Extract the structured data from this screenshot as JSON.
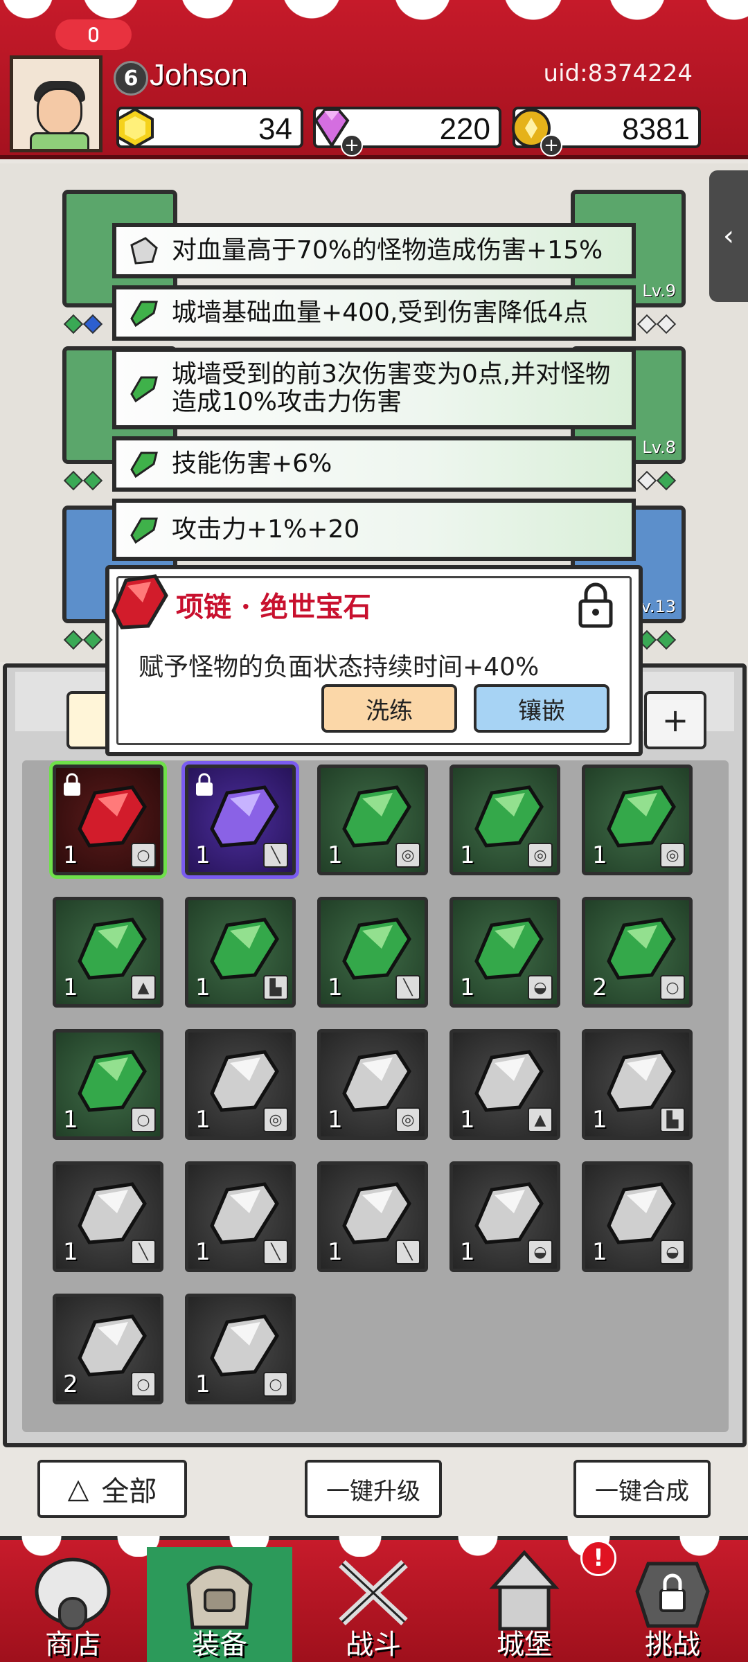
{
  "header": {
    "player_name": "Johson",
    "level": "6",
    "uid": "uid:8374224",
    "currencies": [
      {
        "name": "gem",
        "value": "34",
        "color": "#f5d21c"
      },
      {
        "name": "diamond",
        "value": "220",
        "color": "#d46ee0"
      },
      {
        "name": "coin",
        "value": "8381",
        "color": "#e5b21a"
      }
    ]
  },
  "equipment": {
    "levels": [
      "Lv.9",
      "Lv.8",
      "Lv.13"
    ]
  },
  "affixes": [
    {
      "text": "对血量高于70%的怪物造成伤害+15%",
      "gem": "gray"
    },
    {
      "text": "城墙基础血量+400,受到伤害降低4点",
      "gem": "green"
    },
    {
      "text": "城墙受到的前3次伤害变为0点,并对怪物造成10%攻击力伤害",
      "gem": "green"
    },
    {
      "text": "技能伤害+6%",
      "gem": "green"
    },
    {
      "text": "攻击力+1%+20",
      "gem": "green"
    }
  ],
  "popup": {
    "title": "项链 · 绝世宝石",
    "description": "赋予怪物的负面状态持续时间+40%",
    "refine_label": "洗练",
    "inlay_label": "镶嵌"
  },
  "inventory": {
    "cells": [
      {
        "color": "red",
        "count": "1",
        "slot": "necklace",
        "locked": true
      },
      {
        "color": "purple",
        "count": "1",
        "slot": "weapon",
        "locked": true
      },
      {
        "color": "green",
        "count": "1",
        "slot": "ring"
      },
      {
        "color": "green",
        "count": "1",
        "slot": "ring"
      },
      {
        "color": "green",
        "count": "1",
        "slot": "ring"
      },
      {
        "color": "green",
        "count": "1",
        "slot": "armor"
      },
      {
        "color": "green",
        "count": "1",
        "slot": "boots"
      },
      {
        "color": "green",
        "count": "1",
        "slot": "weapon"
      },
      {
        "color": "green",
        "count": "1",
        "slot": "helmet"
      },
      {
        "color": "green",
        "count": "2",
        "slot": "necklace"
      },
      {
        "color": "green",
        "count": "1",
        "slot": "necklace"
      },
      {
        "color": "gray",
        "count": "1",
        "slot": "ring"
      },
      {
        "color": "gray",
        "count": "1",
        "slot": "ring"
      },
      {
        "color": "gray",
        "count": "1",
        "slot": "armor"
      },
      {
        "color": "gray",
        "count": "1",
        "slot": "boots"
      },
      {
        "color": "gray",
        "count": "1",
        "slot": "weapon"
      },
      {
        "color": "gray",
        "count": "1",
        "slot": "weapon"
      },
      {
        "color": "gray",
        "count": "1",
        "slot": "weapon"
      },
      {
        "color": "gray",
        "count": "1",
        "slot": "helmet"
      },
      {
        "color": "gray",
        "count": "1",
        "slot": "helmet"
      },
      {
        "color": "gray",
        "count": "2",
        "slot": "necklace"
      },
      {
        "color": "gray",
        "count": "1",
        "slot": "necklace"
      }
    ]
  },
  "actions": {
    "all_label": "全部",
    "upgrade_label": "一键升级",
    "merge_label": "一键合成"
  },
  "nav": {
    "items": [
      {
        "label": "商店",
        "icon": "shop-icon"
      },
      {
        "label": "装备",
        "icon": "bag-icon",
        "active": true
      },
      {
        "label": "战斗",
        "icon": "swords-icon"
      },
      {
        "label": "城堡",
        "icon": "castle-icon"
      },
      {
        "label": "挑战",
        "icon": "challenge-icon"
      }
    ],
    "badge": "!"
  }
}
